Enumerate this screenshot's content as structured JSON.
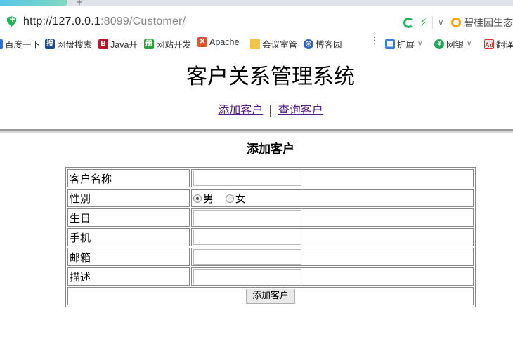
{
  "browser": {
    "new_tab_symbol": "+",
    "url_host": "http://127.0.0.1",
    "url_rest": ":8099/Customer/",
    "search_text": "碧桂园生态"
  },
  "bookmarks": {
    "items": [
      {
        "label": "百度一下",
        "icon": "baidu-icon"
      },
      {
        "label": "网盘搜索",
        "icon": "search-disk-icon"
      },
      {
        "label": "Java开",
        "icon": "bookmark-b-icon"
      },
      {
        "label": "网站开发",
        "icon": "bookmark-green-icon"
      },
      {
        "label": "Apache",
        "icon": "apache-icon"
      },
      {
        "label": "会议室管",
        "icon": "folder-icon"
      },
      {
        "label": "博客园",
        "icon": "blog-icon"
      },
      {
        "label": "扩展",
        "icon": "extension-icon"
      },
      {
        "label": "网银",
        "icon": "bank-icon"
      },
      {
        "label": "翻译",
        "icon": "translate-icon"
      }
    ],
    "more_symbol": "⋮"
  },
  "page": {
    "title": "客户关系管理系统",
    "nav": {
      "add_link": "添加客户",
      "separator": "|",
      "query_link": "查询客户"
    },
    "form_title": "添加客户"
  },
  "form": {
    "name_label": "客户名称",
    "gender_label": "性别",
    "gender_options": [
      "男",
      "女"
    ],
    "gender_selected": "男",
    "birthday_label": "生日",
    "phone_label": "手机",
    "email_label": "邮箱",
    "description_label": "描述",
    "submit_label": "添加客户"
  },
  "colors": {
    "link": "#551a8b",
    "secure_green": "#25b35a"
  }
}
